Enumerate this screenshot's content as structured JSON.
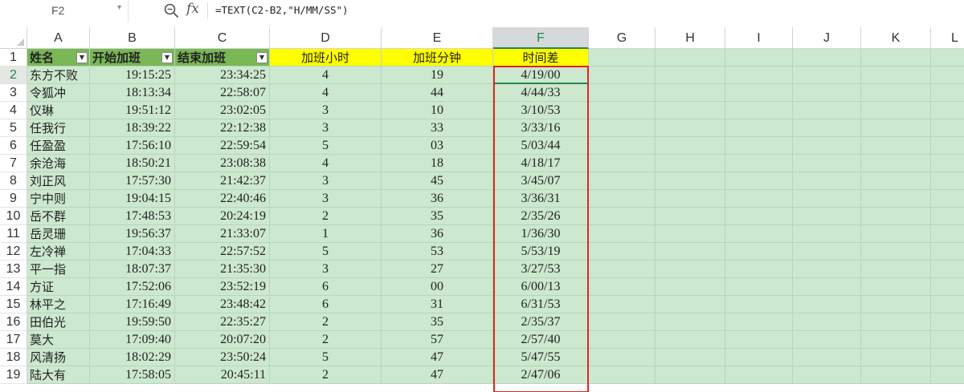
{
  "formula_bar": {
    "name_box": "F2",
    "formula": "=TEXT(C2-B2,\"H/MM/SS\")",
    "icons": [
      "zoom-icon",
      "fx-icon"
    ]
  },
  "sheet": {
    "active_cell": "F2",
    "columns": [
      "A",
      "B",
      "C",
      "D",
      "E",
      "F",
      "G",
      "H",
      "I",
      "J",
      "K",
      "L"
    ],
    "header_row": {
      "A": "姓名",
      "B": "开始加班",
      "C": "结束加班",
      "D": "加班小时",
      "E": "加班分钟",
      "F": "时间差"
    },
    "rows": [
      {
        "num": "2",
        "A": "东方不败",
        "B": "19:15:25",
        "C": "23:34:25",
        "D": "4",
        "E": "19",
        "F": "4/19/00"
      },
      {
        "num": "3",
        "A": "令狐冲",
        "B": "18:13:34",
        "C": "22:58:07",
        "D": "4",
        "E": "44",
        "F": "4/44/33"
      },
      {
        "num": "4",
        "A": "仪琳",
        "B": "19:51:12",
        "C": "23:02:05",
        "D": "3",
        "E": "10",
        "F": "3/10/53"
      },
      {
        "num": "5",
        "A": "任我行",
        "B": "18:39:22",
        "C": "22:12:38",
        "D": "3",
        "E": "33",
        "F": "3/33/16"
      },
      {
        "num": "6",
        "A": "任盈盈",
        "B": "17:56:10",
        "C": "22:59:54",
        "D": "5",
        "E": "03",
        "F": "5/03/44"
      },
      {
        "num": "7",
        "A": "余沧海",
        "B": "18:50:21",
        "C": "23:08:38",
        "D": "4",
        "E": "18",
        "F": "4/18/17"
      },
      {
        "num": "8",
        "A": "刘正风",
        "B": "17:57:30",
        "C": "21:42:37",
        "D": "3",
        "E": "45",
        "F": "3/45/07"
      },
      {
        "num": "9",
        "A": "宁中则",
        "B": "19:04:15",
        "C": "22:40:46",
        "D": "3",
        "E": "36",
        "F": "3/36/31"
      },
      {
        "num": "10",
        "A": "岳不群",
        "B": "17:48:53",
        "C": "20:24:19",
        "D": "2",
        "E": "35",
        "F": "2/35/26"
      },
      {
        "num": "11",
        "A": "岳灵珊",
        "B": "19:56:37",
        "C": "21:33:07",
        "D": "1",
        "E": "36",
        "F": "1/36/30"
      },
      {
        "num": "12",
        "A": "左冷禅",
        "B": "17:04:33",
        "C": "22:57:52",
        "D": "5",
        "E": "53",
        "F": "5/53/19"
      },
      {
        "num": "13",
        "A": "平一指",
        "B": "18:07:37",
        "C": "21:35:30",
        "D": "3",
        "E": "27",
        "F": "3/27/53"
      },
      {
        "num": "14",
        "A": "方证",
        "B": "17:52:06",
        "C": "23:52:19",
        "D": "6",
        "E": "00",
        "F": "6/00/13"
      },
      {
        "num": "15",
        "A": "林平之",
        "B": "17:16:49",
        "C": "23:48:42",
        "D": "6",
        "E": "31",
        "F": "6/31/53"
      },
      {
        "num": "16",
        "A": "田伯光",
        "B": "19:59:50",
        "C": "22:35:27",
        "D": "2",
        "E": "35",
        "F": "2/35/37"
      },
      {
        "num": "17",
        "A": "莫大",
        "B": "17:09:40",
        "C": "20:07:20",
        "D": "2",
        "E": "57",
        "F": "2/57/40"
      },
      {
        "num": "18",
        "A": "风清扬",
        "B": "18:02:29",
        "C": "23:50:24",
        "D": "5",
        "E": "47",
        "F": "5/47/55"
      },
      {
        "num": "19",
        "A": "陆大有",
        "B": "17:58:05",
        "C": "20:45:11",
        "D": "2",
        "E": "47",
        "F": "2/47/06"
      }
    ]
  },
  "colors": {
    "cell_fill": "#cce8cf",
    "header_green": "#79b855",
    "header_yellow": "#ffff00",
    "selection_border": "#d8262b",
    "active_accent": "#1f8a4d"
  }
}
